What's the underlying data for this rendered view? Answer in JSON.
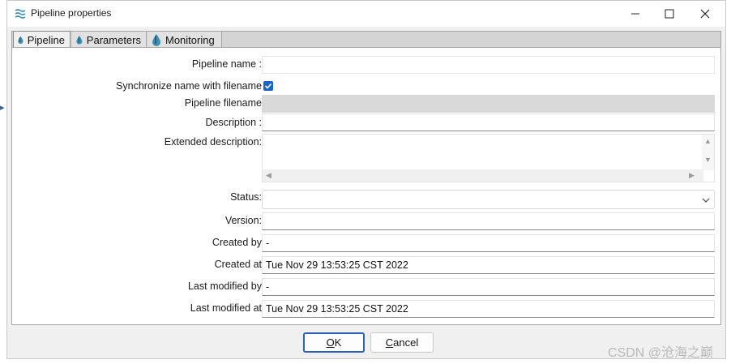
{
  "window": {
    "title": "Pipeline properties",
    "icon": "waves-icon"
  },
  "tabs": [
    {
      "label": "Pipeline",
      "active": true
    },
    {
      "label": "Parameters",
      "active": false
    },
    {
      "label": "Monitoring",
      "active": false
    }
  ],
  "form": {
    "pipeline_name_label": "Pipeline name :",
    "pipeline_name_value": "",
    "sync_label": "Synchronize name with filename",
    "sync_checked": true,
    "pipeline_filename_label": "Pipeline filename",
    "pipeline_filename_value": "",
    "description_label": "Description :",
    "description_value": "",
    "extended_description_label": "Extended description:",
    "extended_description_value": "",
    "status_label": "Status:",
    "status_value": "",
    "version_label": "Version:",
    "version_value": "",
    "created_by_label": "Created by",
    "created_by_value": "-",
    "created_at_label": "Created at",
    "created_at_value": "Tue Nov 29 13:53:25 CST 2022",
    "last_modified_by_label": "Last modified by",
    "last_modified_by_value": "-",
    "last_modified_at_label": "Last modified at",
    "last_modified_at_value": "Tue Nov 29 13:53:25 CST 2022"
  },
  "buttons": {
    "ok_prefix": "",
    "ok_underlined": "O",
    "ok_suffix": "K",
    "cancel_underlined": "C",
    "cancel_suffix": "ancel"
  },
  "watermark": "CSDN @沧海之巅",
  "colors": {
    "accent": "#1667c4",
    "checkbox": "#1667c4"
  }
}
